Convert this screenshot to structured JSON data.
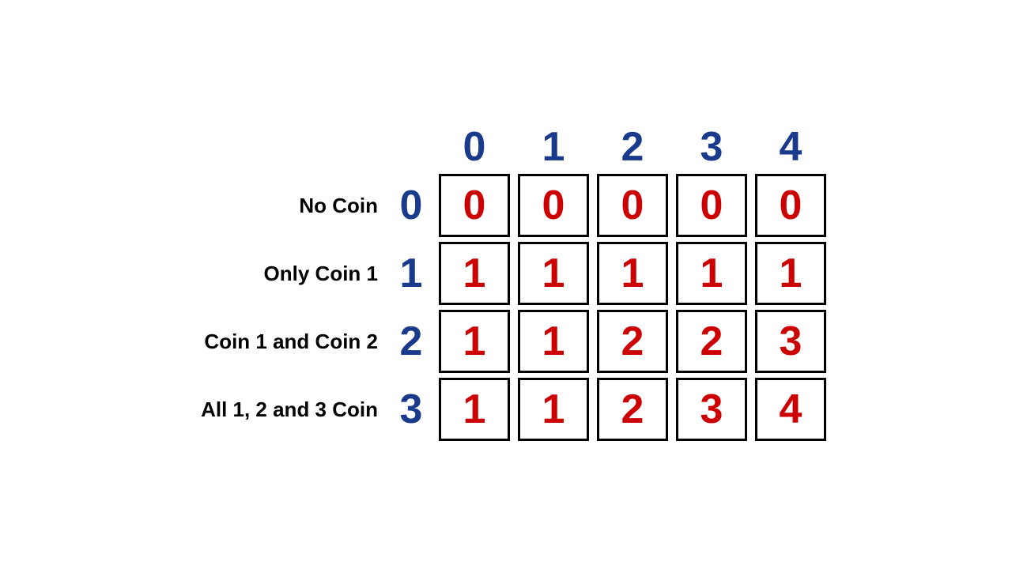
{
  "header": {
    "col_indices": [
      "0",
      "1",
      "2",
      "3",
      "4"
    ]
  },
  "rows": [
    {
      "label": "No Coin",
      "row_index": "0",
      "cells": [
        "0",
        "0",
        "0",
        "0",
        "0"
      ]
    },
    {
      "label": "Only Coin 1",
      "row_index": "1",
      "cells": [
        "1",
        "1",
        "1",
        "1",
        "1"
      ]
    },
    {
      "label": "Coin 1 and Coin 2",
      "row_index": "2",
      "cells": [
        "1",
        "1",
        "2",
        "2",
        "3"
      ]
    },
    {
      "label": "All 1, 2 and 3 Coin",
      "row_index": "3",
      "cells": [
        "1",
        "1",
        "2",
        "3",
        "4"
      ]
    }
  ]
}
